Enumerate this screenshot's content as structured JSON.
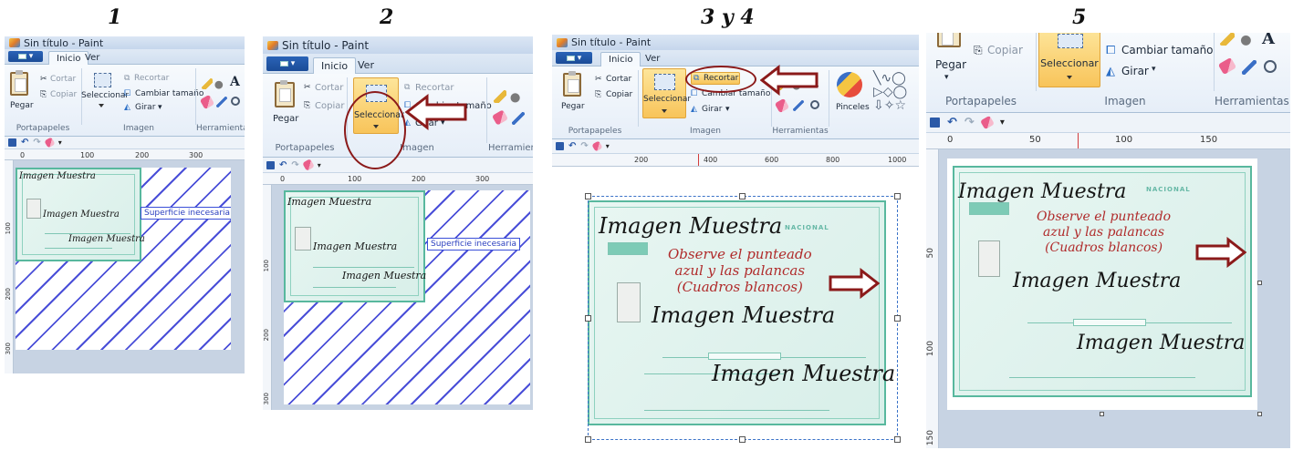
{
  "steps": [
    "1",
    "2",
    "3 y 4",
    "5"
  ],
  "app": {
    "title": "Sin título - Paint",
    "tabs": [
      "Inicio",
      "Ver"
    ]
  },
  "ribbon": {
    "pegar": "Pegar",
    "cortar": "Cortar",
    "copiar": "Copiar",
    "seleccionar": "Seleccionar",
    "recortar": "Recortar",
    "cambiar_tamano": "Cambiar tamaño",
    "girar": "Girar",
    "pinceles": "Pinceles",
    "groups": {
      "portapapeles": "Portapapeles",
      "imagen": "Imagen",
      "herramientas": "Herramientas"
    }
  },
  "rulers": {
    "p1": [
      "0",
      "100",
      "200",
      "300"
    ],
    "p1_v": [
      "100",
      "200",
      "300"
    ],
    "p2": [
      "0",
      "100",
      "200",
      "300"
    ],
    "p2_v": [
      "100",
      "200",
      "300"
    ],
    "p3": [
      "200",
      "400",
      "600",
      "800",
      "1000"
    ],
    "p5": [
      "0",
      "50",
      "100",
      "150"
    ],
    "p5_v": [
      "50",
      "100",
      "150"
    ]
  },
  "canvas": {
    "watermark": "Imagen Muestra",
    "superficie": "Superficie inecesaria",
    "doc_header": "NACIONAL",
    "note_lines": [
      "Observe el punteado",
      "azul y las palancas",
      "(Cuadros blancos)"
    ]
  },
  "colors": {
    "arrow": "#8b1a1a",
    "hatch": "#4a4fd8",
    "selection": "#3b73c8",
    "accent_button": "#f8c45a"
  }
}
